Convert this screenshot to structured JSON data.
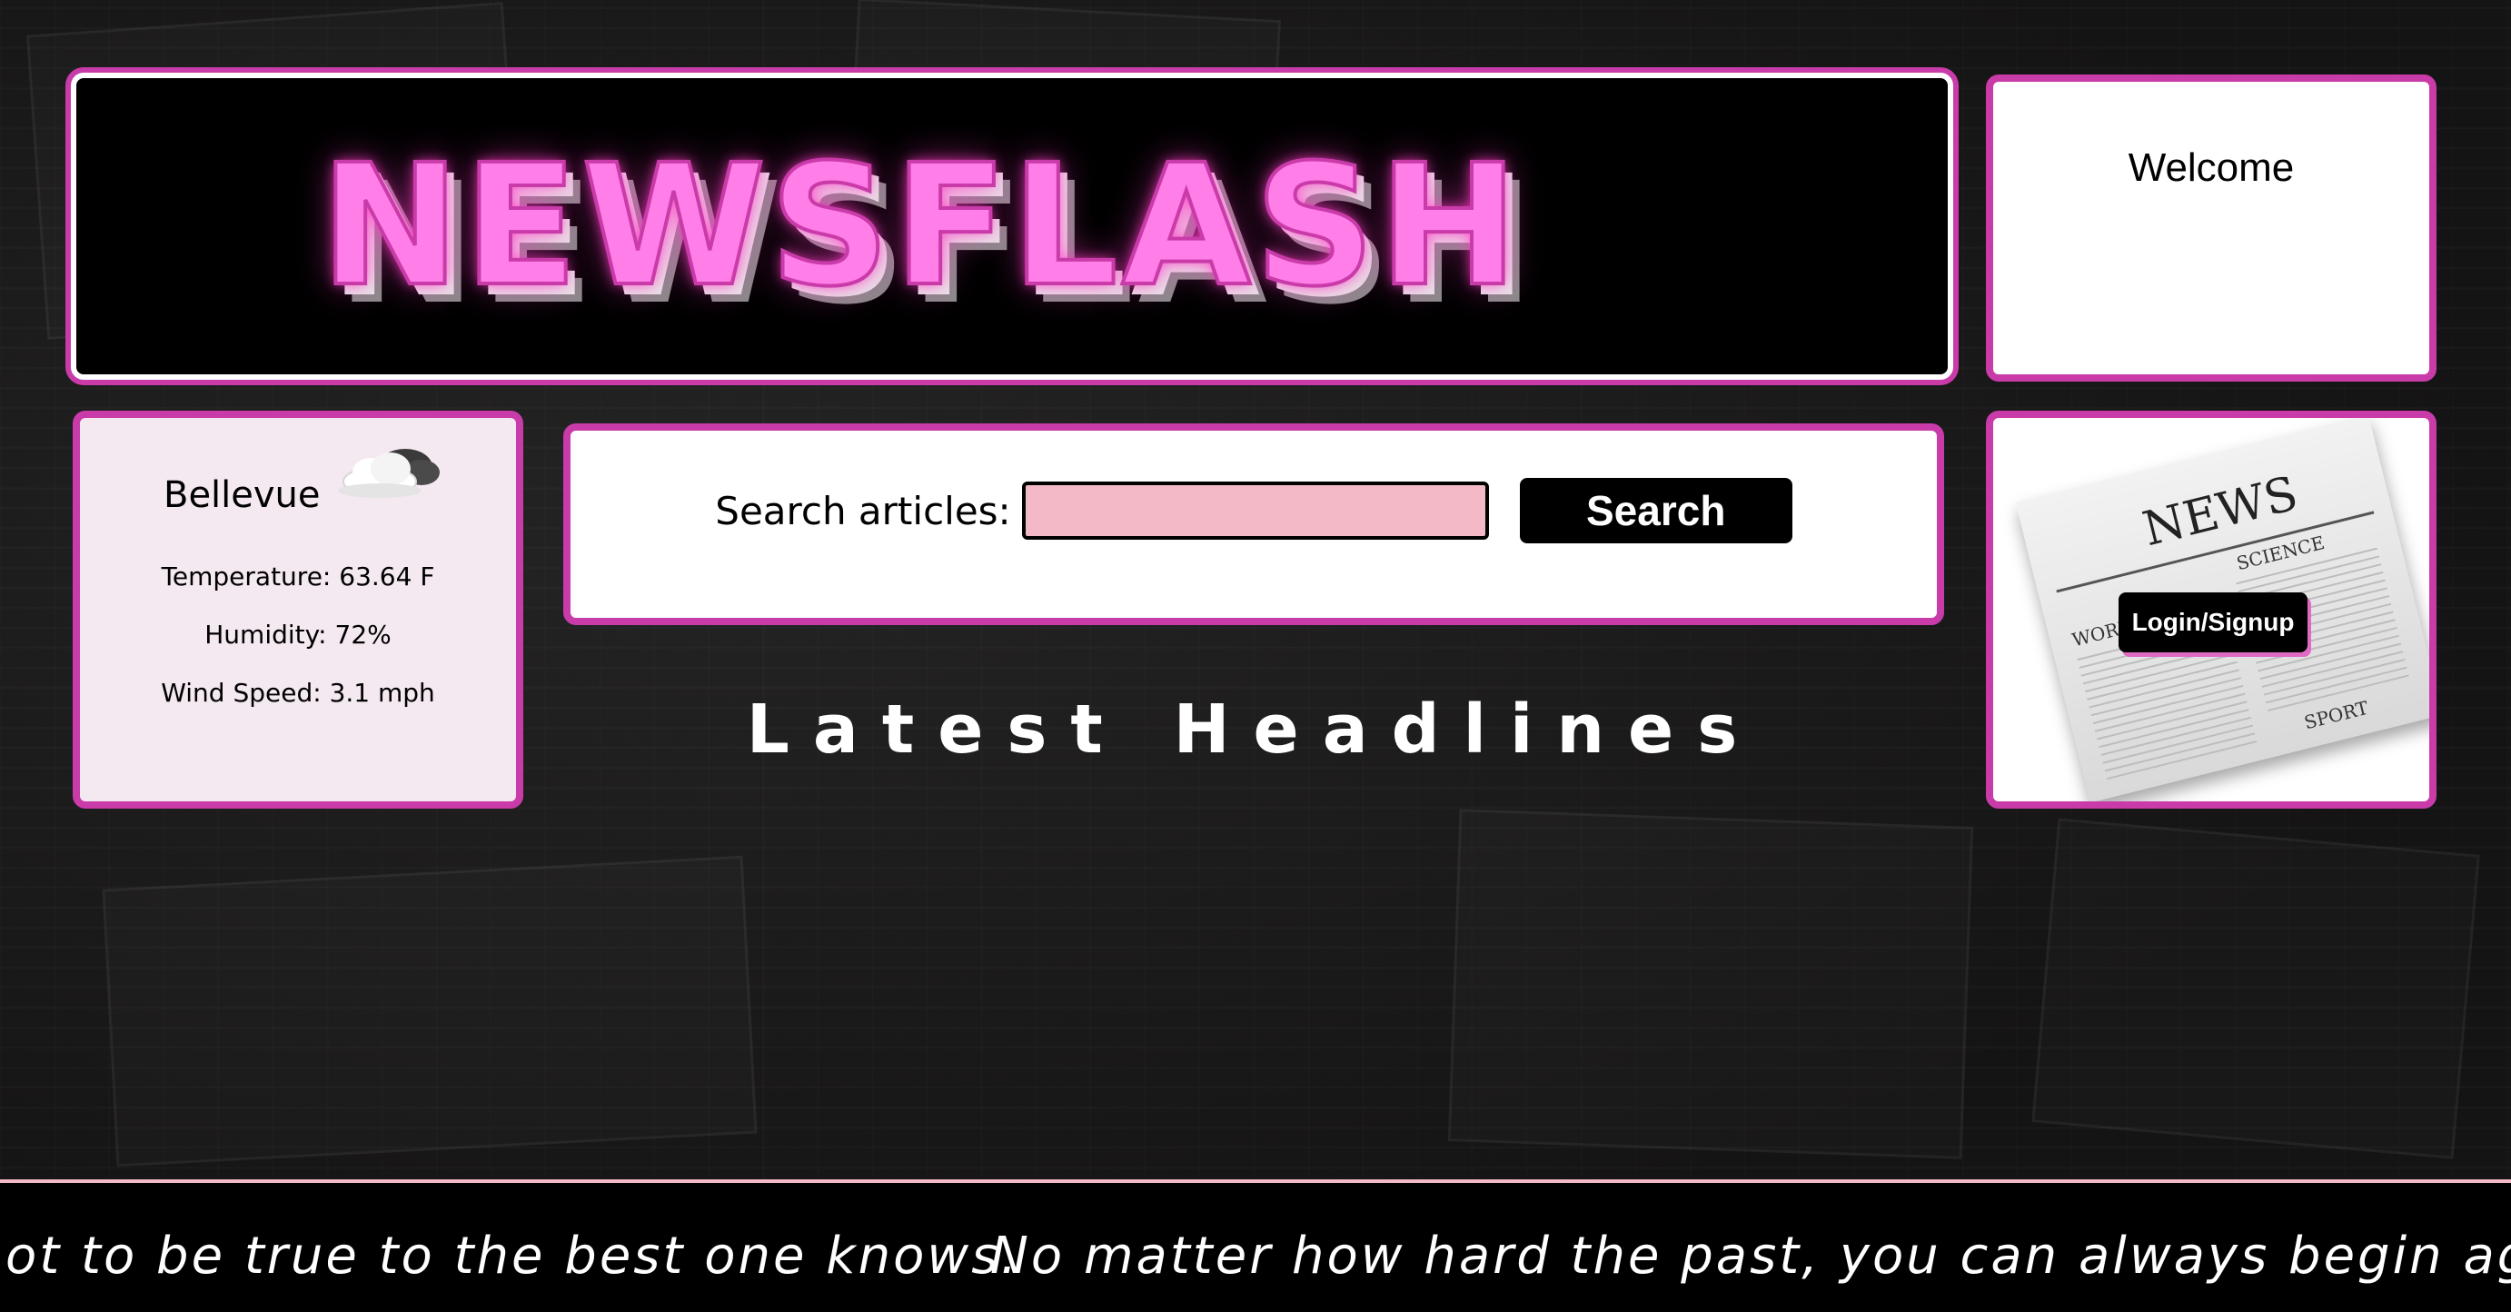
{
  "header": {
    "logo_text": "NEWSFLASH"
  },
  "welcome": {
    "title": "Welcome"
  },
  "weather": {
    "city": "Bellevue",
    "icon": "cloud-icon",
    "temperature": "Temperature: 63.64 F",
    "humidity": "Humidity: 72%",
    "wind": "Wind Speed: 3.1 mph"
  },
  "search": {
    "label": "Search articles:",
    "value": "",
    "placeholder": "",
    "button_label": "Search"
  },
  "headlines": {
    "title": "Latest Headlines"
  },
  "login": {
    "button_label": "Login/Signup",
    "newspaper_image": {
      "title": "NEWS",
      "labels": [
        "SCIENCE",
        "WORLD",
        "SPORT"
      ]
    }
  },
  "ticker": {
    "quotes": [
      "ot to be true to the best one knows.",
      "No matter how hard the past, you can always begin again."
    ]
  },
  "colors": {
    "accent": "#c93ba9",
    "input_bg": "#f4b9c6",
    "neon": "#ff7ee8"
  }
}
